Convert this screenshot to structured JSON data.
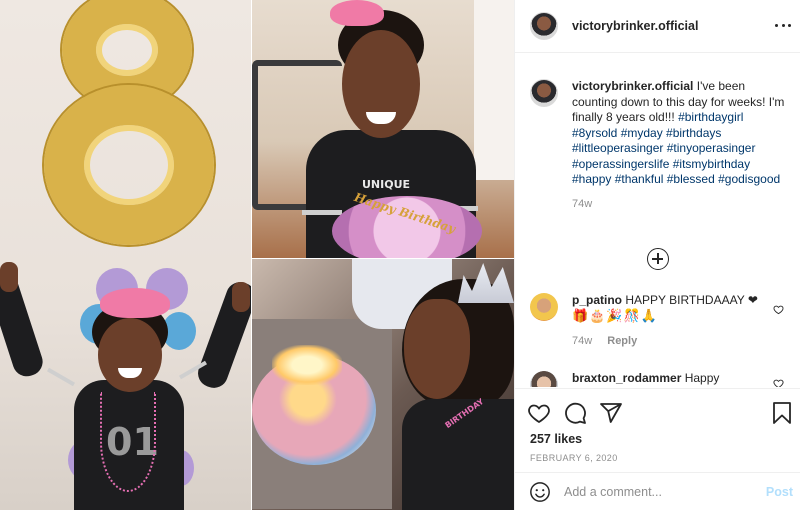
{
  "post": {
    "username": "victorybrinker.official",
    "caption": {
      "username": "victorybrinker.official",
      "text": "I've been counting down to this day for weeks! I'm finally 8 years old!!!",
      "hashtags": "#birthdaygirl #8yrsold #myday #birthdays #littleoperasinger #tinyoperasinger #operassingerslife #itsmybirthday #happy #thankful #blessed #godisgood",
      "age": "74w"
    },
    "comments": [
      {
        "username": "p_patino",
        "text": "HAPPY BIRTHDAAAY ❤",
        "emoji": "🎁🎂🎉🎊🙏",
        "age": "74w",
        "reply_label": "Reply"
      },
      {
        "username": "braxton_rodammer",
        "text": "Happy"
      }
    ],
    "likes": "257 likes",
    "date": "FEBRUARY 6, 2020",
    "add_comment_placeholder": "Add a comment...",
    "post_label": "Post"
  },
  "photo": {
    "shirt_text": "01",
    "tiara_text": "UNIQUE",
    "cake_topper": "Happy Birthday",
    "sash_text": "BIRTHDAY"
  },
  "icons": {
    "more": "more-options-icon",
    "load_more": "load-more-comments-icon",
    "like": "heart-icon",
    "comment": "comment-icon",
    "share": "share-icon",
    "save": "bookmark-icon",
    "emoji": "smiley-icon"
  },
  "colors": {
    "link": "#00376b",
    "muted": "#8e8e8e",
    "post_disabled": "#b2dffc",
    "text": "#262626",
    "balloon_gold": "#d9b24a",
    "bow_pink": "#f07aa6"
  }
}
